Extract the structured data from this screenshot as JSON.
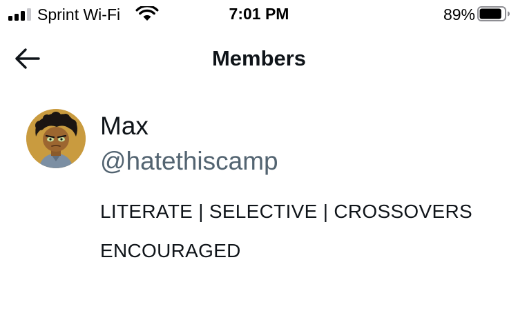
{
  "status_bar": {
    "carrier": "Sprint Wi-Fi",
    "time": "7:01 PM",
    "battery_percent": "89%",
    "battery_level": 0.89,
    "signal_bars_active": 3,
    "signal_bars_total": 4,
    "icons": [
      "signal-icon",
      "wifi-icon",
      "battery-icon"
    ]
  },
  "header": {
    "title": "Members",
    "back_icon": "arrow-left-icon"
  },
  "members": [
    {
      "name": "Max",
      "handle": "@hatethiscamp",
      "bio": "LITERATE | SELECTIVE | CROSSOVERS ENCOURAGED",
      "avatar": "avatar-illustration"
    }
  ],
  "colors": {
    "text_primary": "#0f1419",
    "text_secondary": "#536471",
    "background": "#ffffff"
  }
}
